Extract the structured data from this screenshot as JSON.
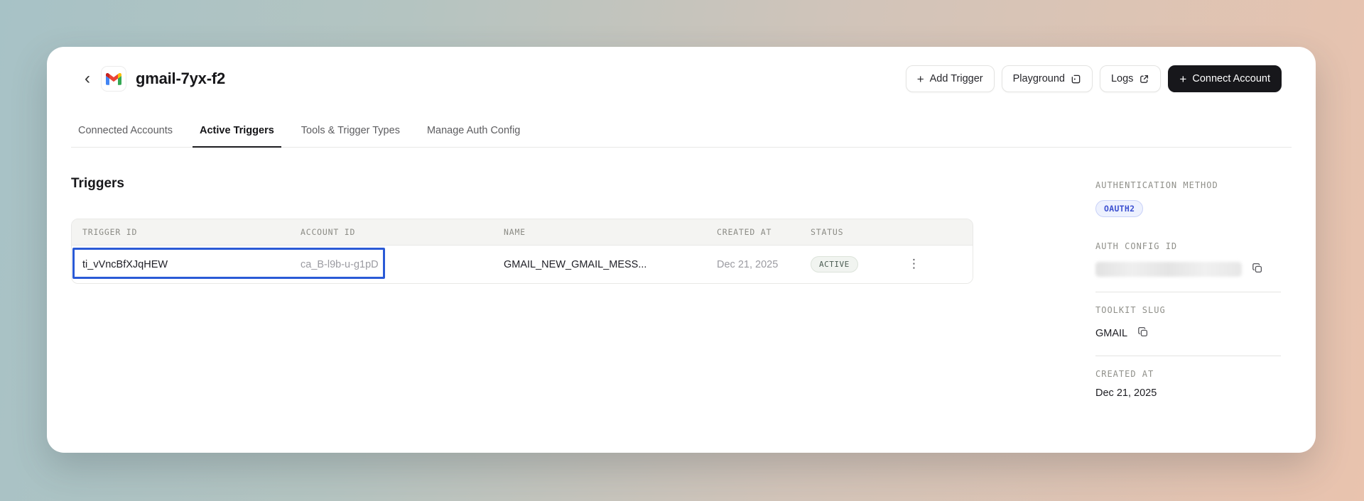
{
  "header": {
    "title": "gmail-7yx-f2",
    "buttons": {
      "add_trigger": "Add Trigger",
      "playground": "Playground",
      "logs": "Logs",
      "connect_account": "Connect Account"
    }
  },
  "icons": {
    "plus": "+",
    "back": "‹",
    "kebab": "⋮"
  },
  "tabs": [
    {
      "label": "Connected Accounts",
      "active": false
    },
    {
      "label": "Active Triggers",
      "active": true
    },
    {
      "label": "Tools & Trigger Types",
      "active": false
    },
    {
      "label": "Manage Auth Config",
      "active": false
    }
  ],
  "main": {
    "heading": "Triggers",
    "table": {
      "columns": [
        "TRIGGER ID",
        "ACCOUNT ID",
        "NAME",
        "CREATED AT",
        "STATUS"
      ],
      "rows": [
        {
          "trigger_id": "ti_vVncBfXJqHEW",
          "account_id": "ca_B-l9b-u-g1pD",
          "name": "GMAIL_NEW_GMAIL_MESS...",
          "created_at": "Dec 21, 2025",
          "status": "ACTIVE",
          "selection": "trigger_id and account_id cells outlined in blue"
        }
      ]
    }
  },
  "sidebar": {
    "authentication_method": {
      "label": "AUTHENTICATION METHOD",
      "value": "OAUTH2"
    },
    "auth_config_id": {
      "label": "AUTH CONFIG ID",
      "value_redacted": true
    },
    "toolkit_slug": {
      "label": "TOOLKIT SLUG",
      "value": "GMAIL"
    },
    "created_at": {
      "label": "CREATED AT",
      "value": "Dec 21, 2025"
    }
  },
  "colors": {
    "selection_outline": "#2a5ad6",
    "active_badge_text": "#4b5c52",
    "oauth2_badge_text": "#3c50d0",
    "connect_button_bg": "#17171b",
    "background_gradient_start": "#a7c2c6",
    "background_gradient_end": "#e9c3ae"
  }
}
